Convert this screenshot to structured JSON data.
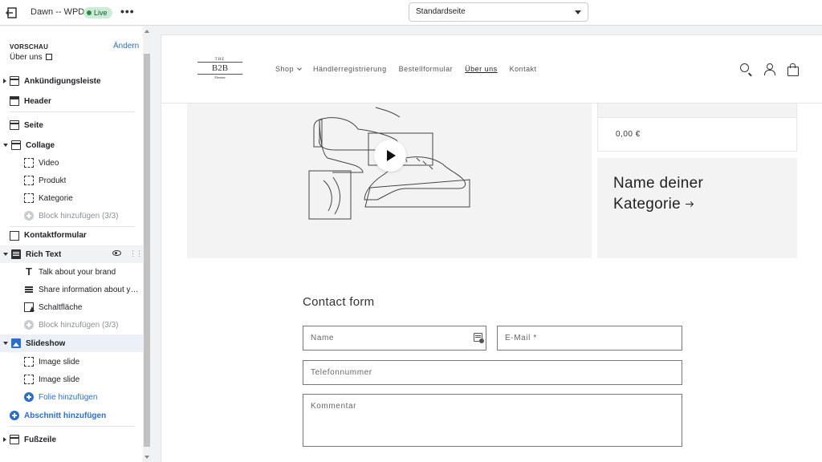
{
  "topbar": {
    "store_name": "Dawn -- WPD",
    "live_badge": "Live",
    "more_label": "•••",
    "template_select": "Standardseite"
  },
  "sidebar": {
    "preview_label": "VORSCHAU",
    "change_link": "Ändern",
    "page_name": "Über uns",
    "items": [
      {
        "label": "Ankündigungsleiste"
      },
      {
        "label": "Header"
      },
      {
        "label": "Seite"
      },
      {
        "label": "Collage"
      },
      {
        "label": "Video"
      },
      {
        "label": "Produkt"
      },
      {
        "label": "Kategorie"
      },
      {
        "label": "Block hinzufügen (3/3)"
      },
      {
        "label": "Kontaktformular"
      },
      {
        "label": "Rich Text"
      },
      {
        "label": "Talk about your brand"
      },
      {
        "label": "Share information about your..."
      },
      {
        "label": "Schaltfläche"
      },
      {
        "label": "Block hinzufügen (3/3)"
      },
      {
        "label": "Slideshow"
      },
      {
        "label": "Image slide"
      },
      {
        "label": "Image slide"
      },
      {
        "label": "Folie hinzufügen"
      },
      {
        "label": "Abschnitt hinzufügen"
      },
      {
        "label": "Fußzeile"
      }
    ]
  },
  "store": {
    "logo": {
      "the": "THE",
      "b2b": "B2B",
      "sub": "Element"
    },
    "nav": [
      "Shop",
      "Händlerregistrierung",
      "Bestellformular",
      "Über uns",
      "Kontakt"
    ],
    "price": "0,00 €",
    "category_title": "Name deiner Kategorie",
    "contact_title": "Contact form",
    "fields": {
      "name": "Name",
      "email": "E-Mail *",
      "phone": "Telefonnummer",
      "comment": "Kommentar"
    }
  },
  "colors": {
    "accent": "#2c6ecb",
    "live_bg": "#cdebd7",
    "live_text": "#0d5a2f"
  }
}
